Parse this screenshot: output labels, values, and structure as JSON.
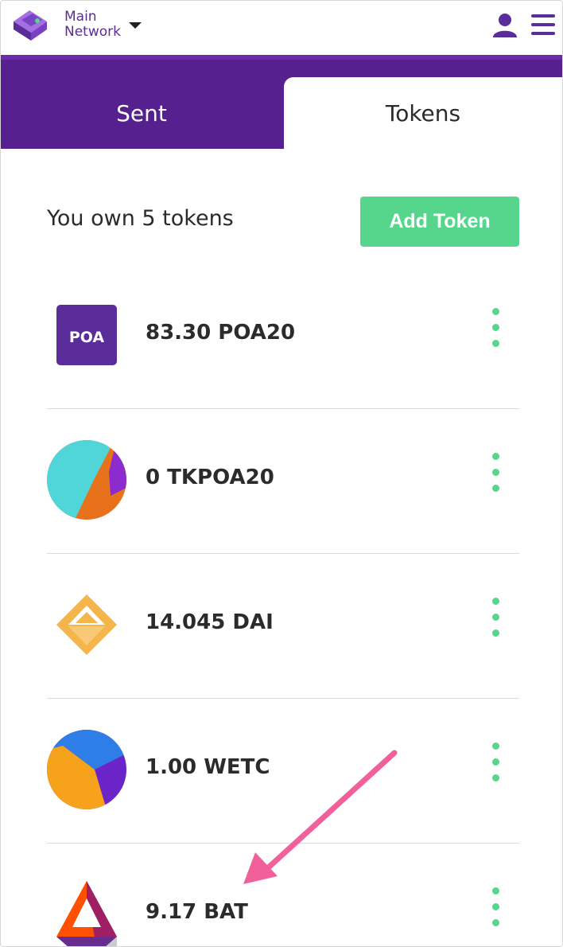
{
  "header": {
    "network_line1": "Main",
    "network_line2": "Network",
    "logo_icon": "wallet-logo-icon",
    "user_icon": "user-icon",
    "menu_icon": "hamburger-menu-icon"
  },
  "tabs": [
    {
      "label": "Sent",
      "active": false
    },
    {
      "label": "Tokens",
      "active": true
    }
  ],
  "summary": {
    "own_text": "You own 5 tokens",
    "add_button": "Add Token"
  },
  "tokens": [
    {
      "label": "83.30 POA20",
      "logo_text": "POA",
      "icon": "poa-logo-icon"
    },
    {
      "label": "0 TKPOA20",
      "icon": "identicon-icon"
    },
    {
      "label": "14.045 DAI",
      "icon": "dai-logo-icon"
    },
    {
      "label": "1.00 WETC",
      "icon": "identicon-icon"
    },
    {
      "label": "9.17 BAT",
      "icon": "bat-logo-icon"
    }
  ],
  "colors": {
    "brand_purple": "#56208f",
    "accent_green": "#56d68c",
    "annotation_pink": "#f2609c"
  }
}
